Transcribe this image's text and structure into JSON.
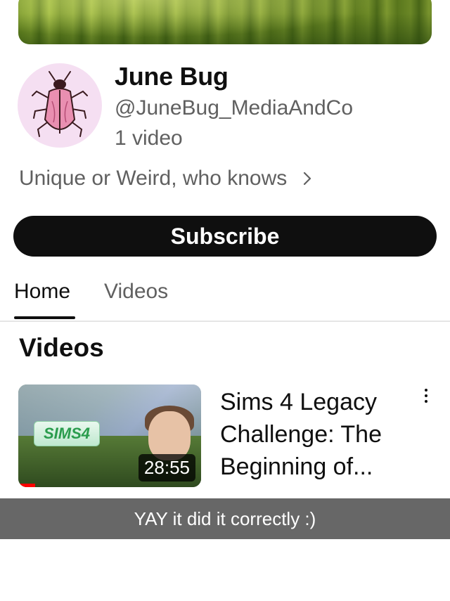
{
  "channel": {
    "name": "June Bug",
    "handle": "@JuneBug_MediaAndCo",
    "video_count": "1 video",
    "description": "Unique or Weird, who knows",
    "avatar_icon": "beetle-icon",
    "subscribe_label": "Subscribe"
  },
  "tabs": [
    {
      "label": "Home",
      "active": true
    },
    {
      "label": "Videos",
      "active": false
    }
  ],
  "section": {
    "title": "Videos"
  },
  "videos": [
    {
      "title": "Sims 4 Legacy Challenge: The Beginning of...",
      "duration": "28:55",
      "thumbnail_logo": "SIMS4",
      "menu_icon": "more-vertical-icon"
    }
  ],
  "overlay_caption": "YAY it did it correctly :)",
  "colors": {
    "accent": "#0f0f0f",
    "secondary_text": "#606060",
    "progress": "#ff0000",
    "avatar_bg": "#f5dff2"
  }
}
